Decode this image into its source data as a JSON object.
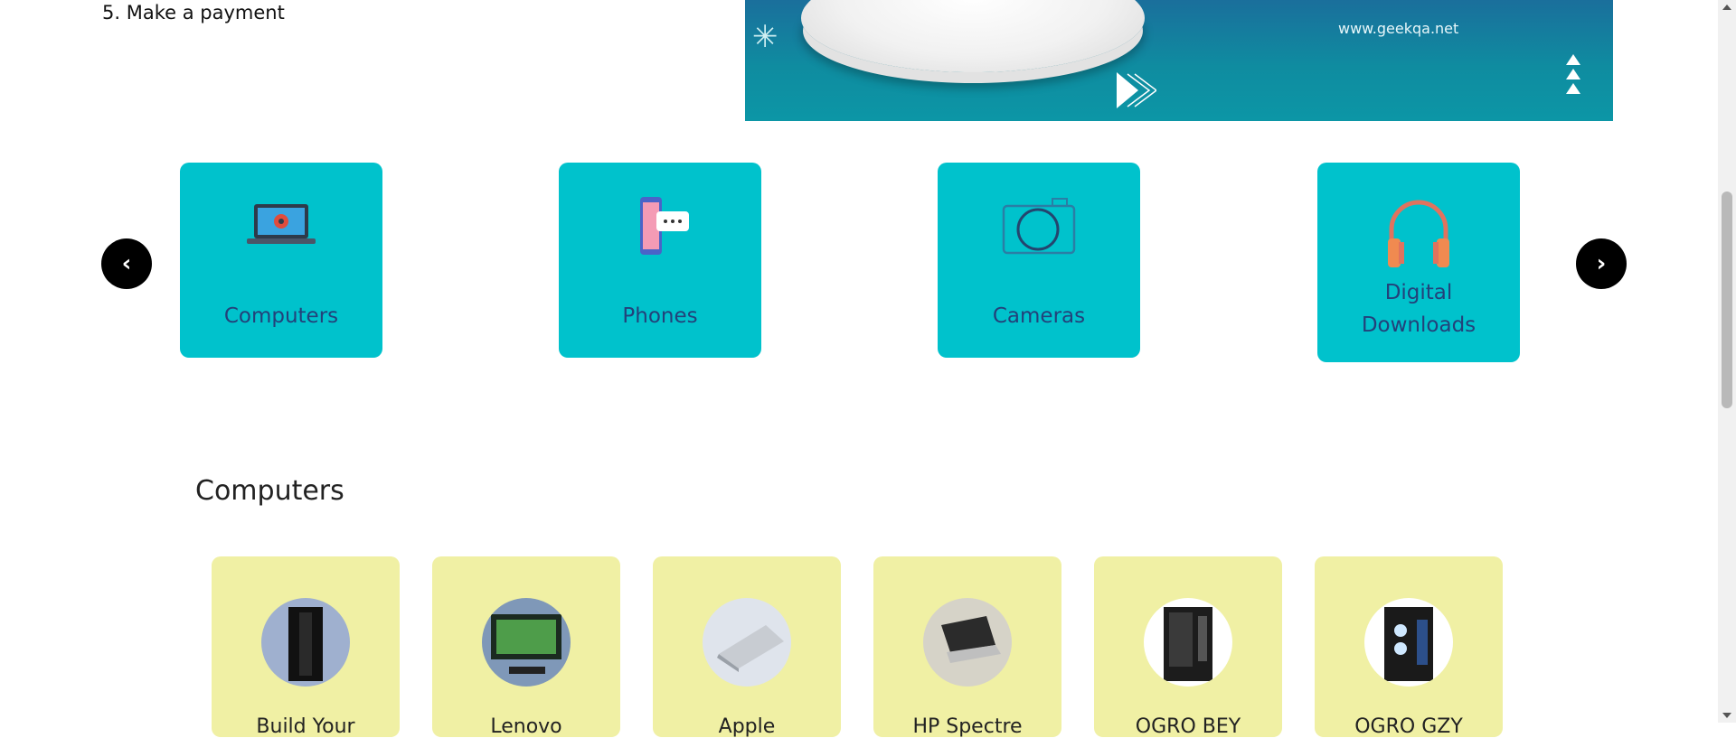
{
  "intro": {
    "step5": "5. Make a payment"
  },
  "banner": {
    "url": "www.geekqa.net"
  },
  "carousel": {
    "prev": "‹",
    "next": "›",
    "items": [
      {
        "label": "Computers",
        "icon": "laptop-icon"
      },
      {
        "label": "Phones",
        "icon": "phone-chat-icon"
      },
      {
        "label": "Cameras",
        "icon": "camera-icon"
      },
      {
        "label": "Digital Downloads",
        "icon": "headphones-icon"
      }
    ]
  },
  "section": {
    "title": "Computers"
  },
  "products": [
    {
      "name": "Build Your",
      "image": "tower-pc"
    },
    {
      "name": "Lenovo",
      "image": "all-in-one-desktop"
    },
    {
      "name": "Apple",
      "image": "silver-laptop"
    },
    {
      "name": "HP Spectre",
      "image": "laptop-on-stand"
    },
    {
      "name": "OGRO BEY",
      "image": "gaming-tower"
    },
    {
      "name": "OGRO GZY",
      "image": "gaming-tower-rgb"
    }
  ],
  "colors": {
    "category_card": "#00c2cc",
    "category_label": "#23417a",
    "product_card": "#f0f0a4",
    "nav_button": "#000000"
  }
}
